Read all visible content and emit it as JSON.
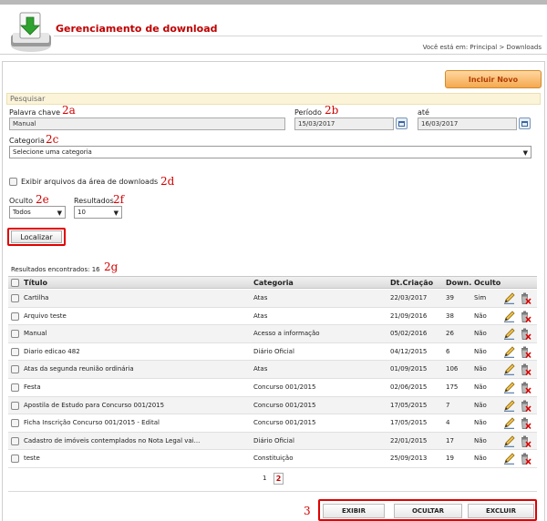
{
  "header": {
    "title": "Gerenciamento de download",
    "breadcrumb": "Você está em: Principal > Downloads"
  },
  "actions": {
    "new_button": "Incluir Novo"
  },
  "search": {
    "section_title": "Pesquisar",
    "keyword_label": "Palavra chave",
    "keyword_value": "Manual",
    "period_label": "Período",
    "period_from": "15/03/2017",
    "until_label": "até",
    "period_to": "16/03/2017",
    "category_label": "Categoria",
    "category_value": "Selecione uma categoria",
    "show_files_label": "Exibir arquivos da área de downloads",
    "hidden_label": "Oculto",
    "hidden_value": "Todos",
    "results_label": "Resultados",
    "results_value": "10",
    "find_button": "Localizar",
    "found_label": "Resultados encontrados:",
    "found_count": "16"
  },
  "annotations": {
    "a": "2a",
    "b": "2b",
    "c": "2c",
    "d": "2d",
    "e": "2e",
    "f": "2f",
    "g": "2g",
    "three": "3"
  },
  "table": {
    "columns": [
      "Título",
      "Categoria",
      "Dt.Criação",
      "Down.",
      "Oculto"
    ],
    "rows": [
      {
        "title": "Cartilha",
        "category": "Atas",
        "date": "22/03/2017",
        "downloads": "39",
        "hidden": "Sim"
      },
      {
        "title": "Arquivo teste",
        "category": "Atas",
        "date": "21/09/2016",
        "downloads": "38",
        "hidden": "Não"
      },
      {
        "title": "Manual",
        "category": "Acesso a informação",
        "date": "05/02/2016",
        "downloads": "26",
        "hidden": "Não"
      },
      {
        "title": "Diario edicao 482",
        "category": "Diário Oficial",
        "date": "04/12/2015",
        "downloads": "6",
        "hidden": "Não"
      },
      {
        "title": "Atas da segunda reunião ordinária",
        "category": "Atas",
        "date": "01/09/2015",
        "downloads": "106",
        "hidden": "Não"
      },
      {
        "title": "Festa",
        "category": "Concurso 001/2015",
        "date": "02/06/2015",
        "downloads": "175",
        "hidden": "Não"
      },
      {
        "title": "Apostila de Estudo para Concurso 001/2015",
        "category": "Concurso 001/2015",
        "date": "17/05/2015",
        "downloads": "7",
        "hidden": "Não"
      },
      {
        "title": "Ficha Inscrição Concurso 001/2015 - Edital",
        "category": "Concurso 001/2015",
        "date": "17/05/2015",
        "downloads": "4",
        "hidden": "Não"
      },
      {
        "title": "Cadastro de imóveis contemplados no Nota Legal vai...",
        "category": "Diário Oficial",
        "date": "22/01/2015",
        "downloads": "17",
        "hidden": "Não"
      },
      {
        "title": "teste",
        "category": "Constituição",
        "date": "25/09/2013",
        "downloads": "19",
        "hidden": "Não"
      }
    ]
  },
  "pagination": {
    "page1": "1",
    "page2": "2"
  },
  "bulk": {
    "show": "EXIBIR",
    "hide": "OCULTAR",
    "delete": "EXCLUIR"
  },
  "icons": {
    "logo": "download-drive-icon",
    "edit": "pencil-icon",
    "delete": "trash-x-icon",
    "calendar": "calendar-icon"
  },
  "colors": {
    "title": "#c00000",
    "annotation": "#d40000",
    "new_button": "#f4a850"
  }
}
